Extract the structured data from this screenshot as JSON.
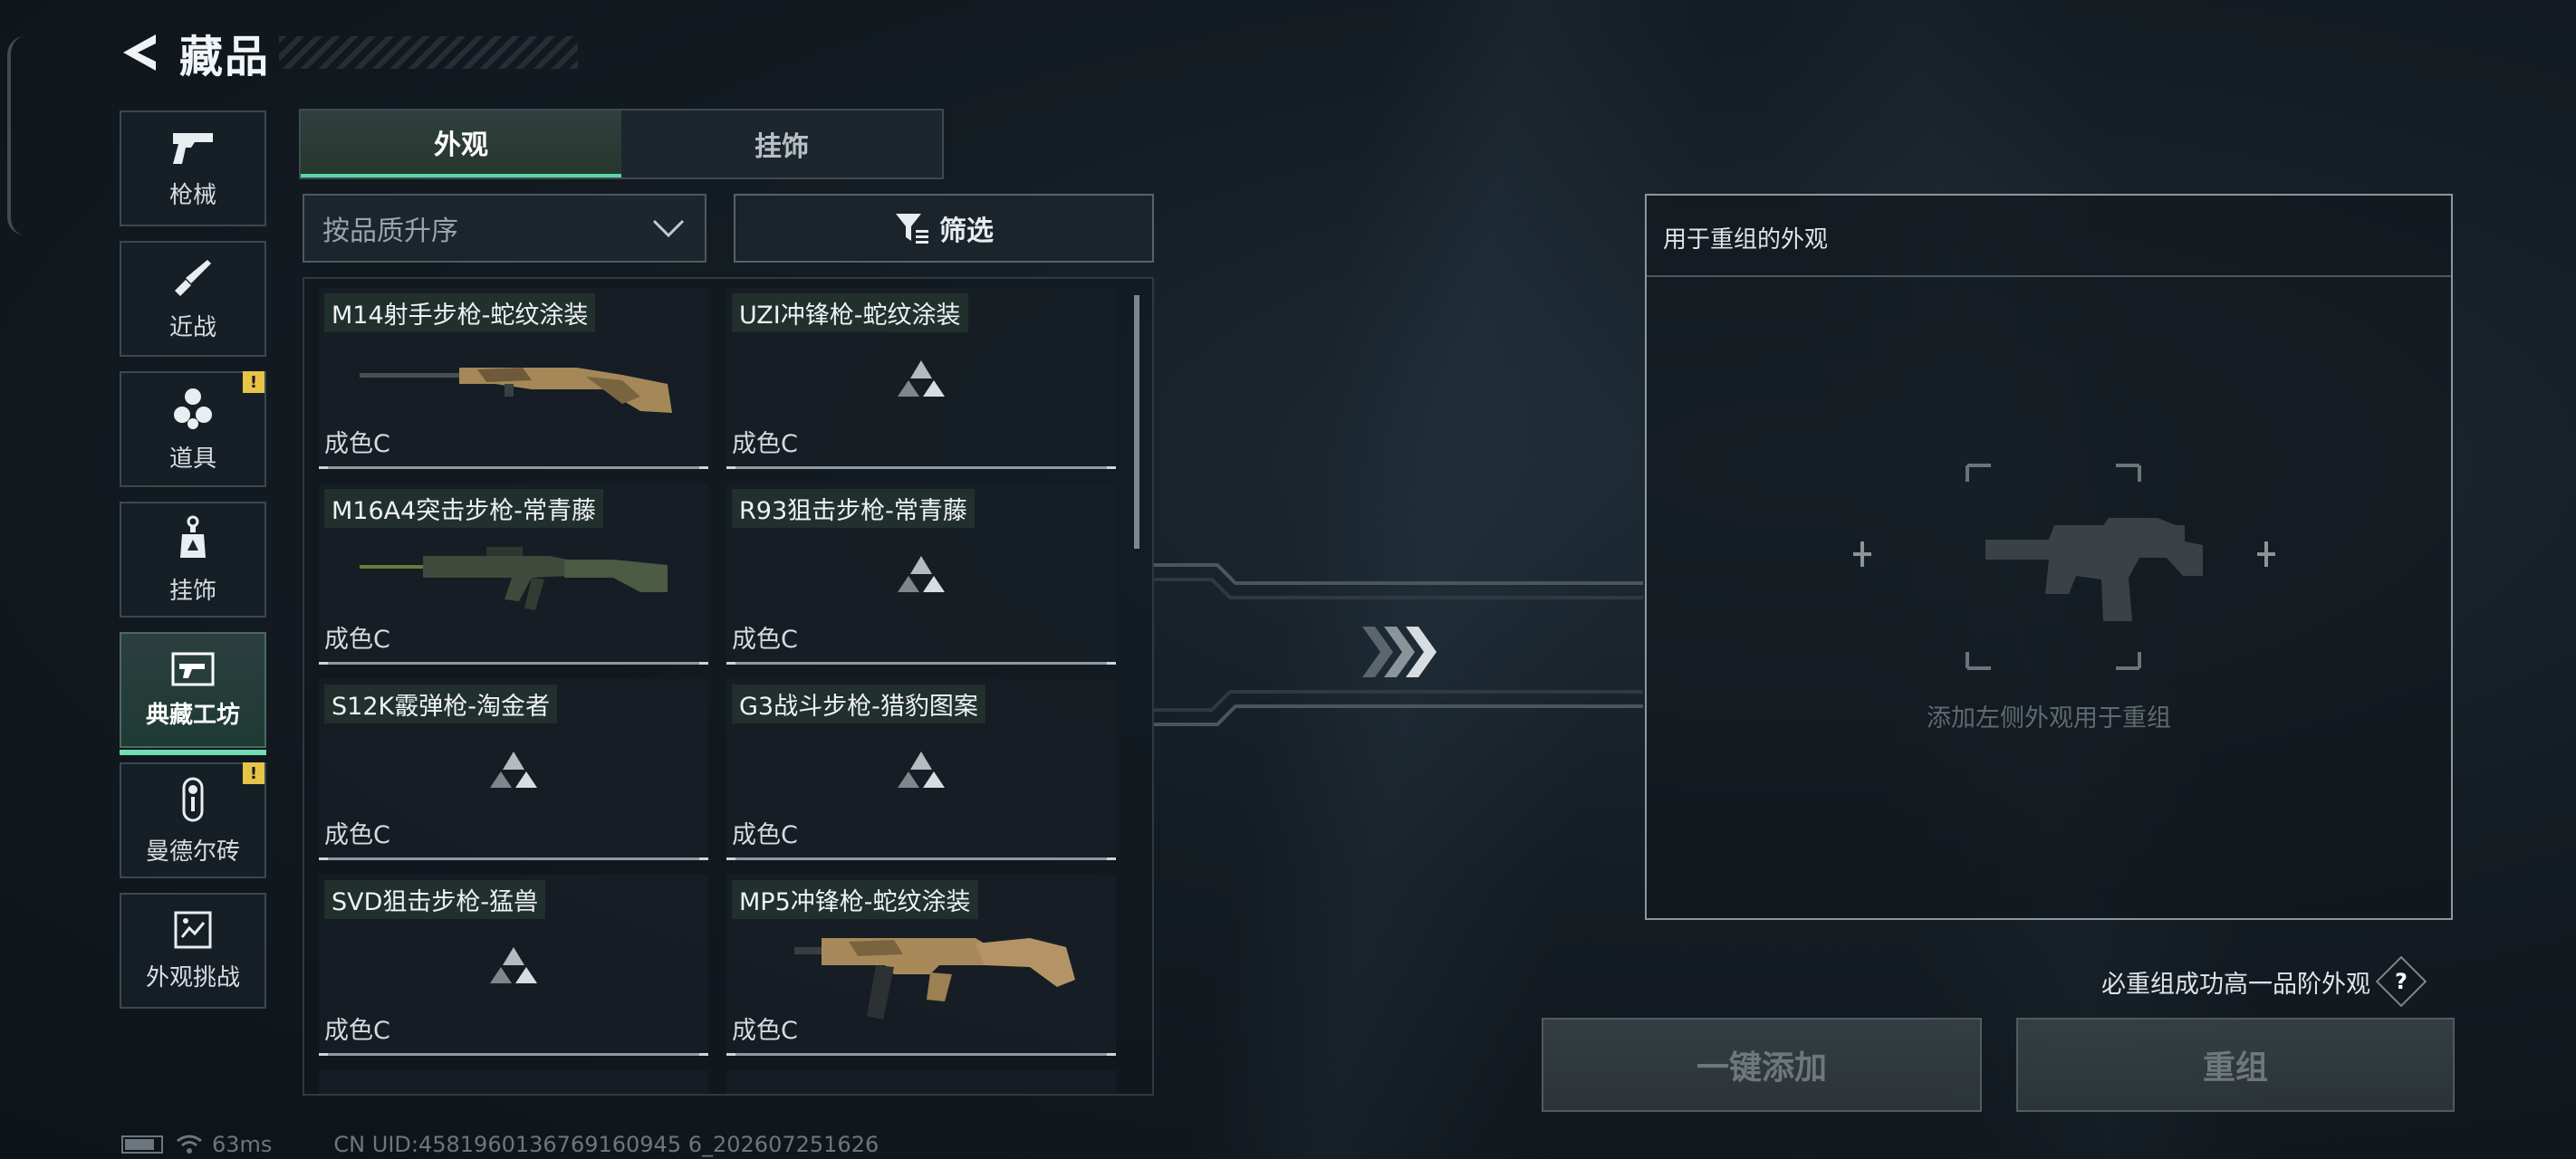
{
  "header": {
    "title": "藏品"
  },
  "sidenav": {
    "items": [
      {
        "label": "枪械",
        "icon": "pistol-icon",
        "badge": ""
      },
      {
        "label": "近战",
        "icon": "knife-icon",
        "badge": ""
      },
      {
        "label": "道具",
        "icon": "grenade-icon",
        "badge": "!"
      },
      {
        "label": "挂饰",
        "icon": "charm-icon",
        "badge": ""
      },
      {
        "label": "典藏工坊",
        "icon": "workshop-icon",
        "badge": "",
        "active": true
      },
      {
        "label": "曼德尔砖",
        "icon": "brick-icon",
        "badge": "!"
      },
      {
        "label": "外观挑战",
        "icon": "challenge-icon",
        "badge": ""
      }
    ]
  },
  "tabs": [
    {
      "label": "外观",
      "active": true
    },
    {
      "label": "挂饰",
      "active": false
    }
  ],
  "sort": {
    "value": "按品质升序"
  },
  "filter": {
    "label": "筛选"
  },
  "items": [
    {
      "name": "M14射手步枪-蛇纹涂装",
      "grade": "成色C",
      "image": "m14-rifle"
    },
    {
      "name": "UZI冲锋枪-蛇纹涂装",
      "grade": "成色C",
      "image": "placeholder-triangle-icon"
    },
    {
      "name": "M16A4突击步枪-常青藤",
      "grade": "成色C",
      "image": "m16a4-rifle"
    },
    {
      "name": "R93狙击步枪-常青藤",
      "grade": "成色C",
      "image": "placeholder-triangle-icon"
    },
    {
      "name": "S12K霰弹枪-淘金者",
      "grade": "成色C",
      "image": "placeholder-triangle-icon"
    },
    {
      "name": "G3战斗步枪-猎豹图案",
      "grade": "成色C",
      "image": "placeholder-triangle-icon"
    },
    {
      "name": "SVD狙击步枪-猛兽",
      "grade": "成色C",
      "image": "placeholder-triangle-icon"
    },
    {
      "name": "MP5冲锋枪-蛇纹涂装",
      "grade": "成色C",
      "image": "mp5-smg"
    }
  ],
  "remake": {
    "header": "用于重组的外观",
    "hint": "添加左侧外观用于重组",
    "guarantee": "必重组成功高一品阶外观",
    "help": "?",
    "add_button": "一键添加",
    "remake_button": "重组"
  },
  "status": {
    "ping": "63ms",
    "uid": "CN UID:4581960136769160945 6_202607251626"
  },
  "colors": {
    "accent": "#5bd6a2",
    "badge": "#e6c447"
  }
}
